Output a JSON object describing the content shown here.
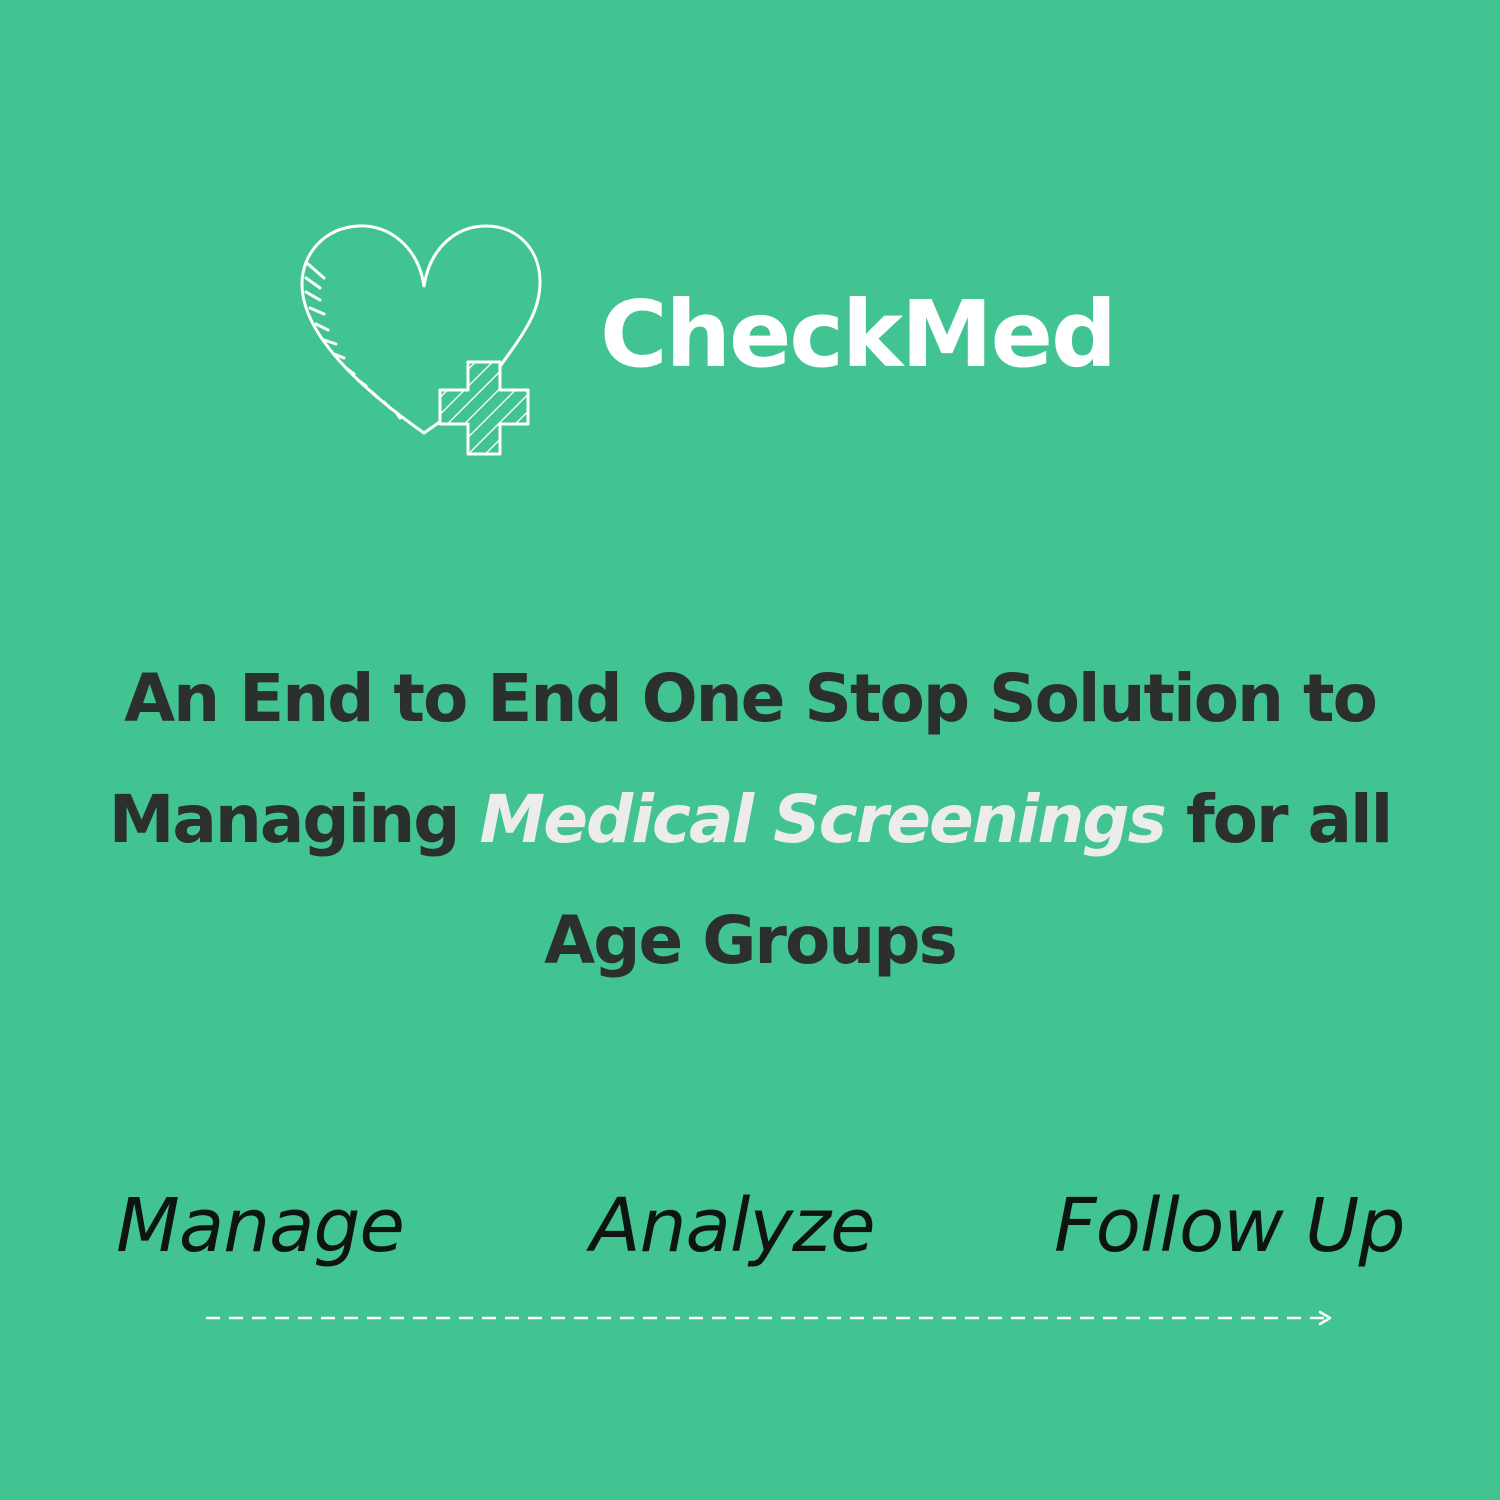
{
  "brand": {
    "name": "CheckMed",
    "logo_icon": "heart-with-medical-cross-icon"
  },
  "headline": {
    "line1": "An End to End One Stop Solution to",
    "line2_pre": "Managing",
    "line2_highlight": "Medical Screenings",
    "line2_post": "for all",
    "line3": "Age Groups"
  },
  "steps": [
    {
      "label": "Manage"
    },
    {
      "label": "Analyze"
    },
    {
      "label": "Follow Up"
    }
  ],
  "flow_icon": "dashed-arrow-right-icon",
  "colors": {
    "background": "#41c492",
    "headline_text": "#2b2f2e",
    "highlight_text": "#ececec",
    "logo": "#ffffff",
    "steps_text": "#0e1412"
  }
}
